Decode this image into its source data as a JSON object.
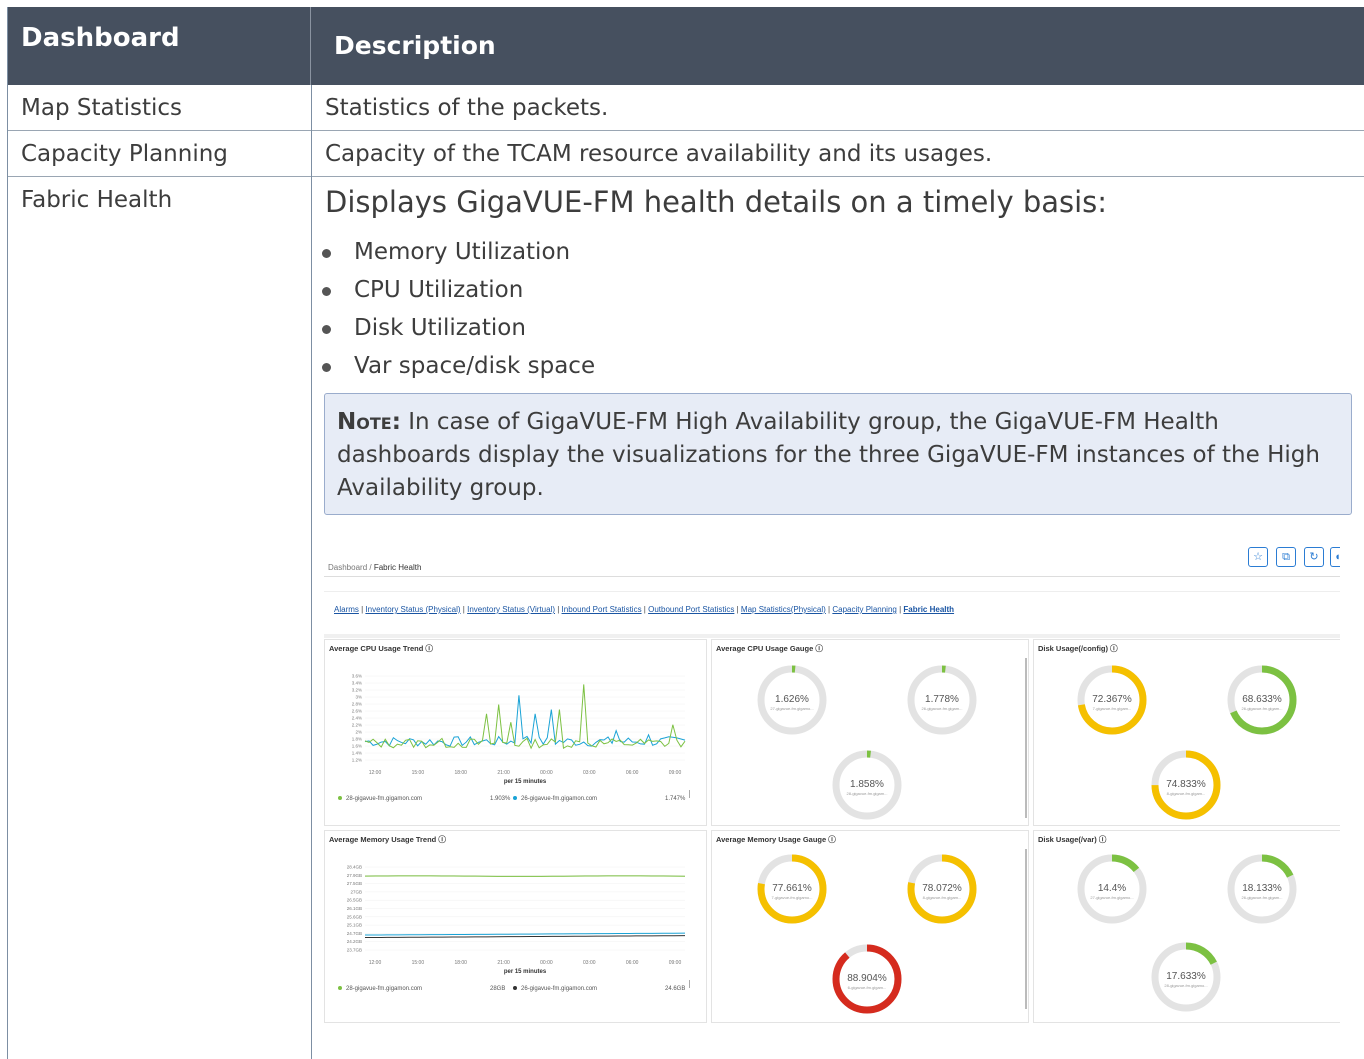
{
  "table": {
    "headers": [
      "Dashboard",
      "Description"
    ],
    "rows": [
      {
        "name": "Map Statistics",
        "desc": "Statistics of the packets."
      },
      {
        "name": "Capacity Planning",
        "desc": "Capacity of the TCAM resource availability and its usages."
      },
      {
        "name": "Fabric Health",
        "desc": "Displays GigaVUE-FM health details on a timely basis:"
      }
    ],
    "bullets": [
      "Memory Utilization",
      "CPU Utilization",
      "Disk Utilization",
      "Var space/disk space"
    ],
    "note_label": "Note:",
    "note_text": "In case of GigaVUE-FM High Availability group, the GigaVUE-FM Health dashboards display the visualizations for the three GigaVUE-FM instances of the High Availability group."
  },
  "screenshot": {
    "breadcrumb": [
      "Dashboard",
      "Fabric Health"
    ],
    "toolbar_icons": [
      "star-icon",
      "copy-icon",
      "refresh-icon",
      "more-icon"
    ],
    "links": [
      "Alarms",
      "Inventory Status (Physical)",
      "Inventory Status (Virtual)",
      "Inbound Port Statistics",
      "Outbound Port Statistics",
      "Map Statistics(Physical)",
      "Capacity Planning",
      "Fabric Health"
    ],
    "panels": {
      "cpu_trend": {
        "title": "Average CPU Usage Trend",
        "y_ticks": [
          "3.6%",
          "3.4%",
          "3.2%",
          "3%",
          "2.8%",
          "2.6%",
          "2.4%",
          "2.2%",
          "2%",
          "1.8%",
          "1.6%",
          "1.4%",
          "1.2%"
        ],
        "x_ticks": [
          "12:00",
          "15:00",
          "18:00",
          "21:00",
          "00:00",
          "03:00",
          "06:00",
          "09:00"
        ],
        "xlabel": "per 15 minutes",
        "legend": [
          {
            "name": "28-gigavue-fm.gigamon.com",
            "value": "1.903%",
            "color": "#7cc142"
          },
          {
            "name": "26-gigavue-fm.gigamon.com",
            "value": "1.747%",
            "color": "#1aa3d6"
          }
        ]
      },
      "cpu_gauge": {
        "title": "Average CPU Usage Gauge",
        "gauges": [
          {
            "value": "1.626%",
            "label": "27-gigavue-fm.gigamo...",
            "pct": 1.626
          },
          {
            "value": "1.778%",
            "label": "26-gigavue-fm.gigam...",
            "pct": 1.778
          },
          {
            "value": "1.858%",
            "label": "28-gigavue-fm.gigam...",
            "pct": 1.858
          }
        ]
      },
      "disk_config": {
        "title": "Disk Usage(/config)",
        "gauges": [
          {
            "value": "72.367%",
            "label": "7-gigavue-fm.gigam...",
            "pct": 72.367
          },
          {
            "value": "68.633%",
            "label": "26-gigavue-fm.gigam...",
            "pct": 68.633
          },
          {
            "value": "74.833%",
            "label": "8-gigavue-fm.gigam...",
            "pct": 74.833
          }
        ]
      },
      "mem_trend": {
        "title": "Average Memory Usage Trend",
        "y_ticks": [
          "28.4GB",
          "27.9GB",
          "27.5GB",
          "27GB",
          "26.5GB",
          "26.1GB",
          "25.6GB",
          "25.1GB",
          "24.7GB",
          "24.2GB",
          "23.7GB"
        ],
        "x_ticks": [
          "12:00",
          "15:00",
          "18:00",
          "21:00",
          "00:00",
          "03:00",
          "06:00",
          "09:00"
        ],
        "xlabel": "per 15 minutes",
        "legend": [
          {
            "name": "28-gigavue-fm.gigamon.com",
            "value": "28GB",
            "color": "#7cc142"
          },
          {
            "name": "26-gigavue-fm.gigamon.com",
            "value": "24.6GB",
            "color": "#333333"
          }
        ]
      },
      "mem_gauge": {
        "title": "Average Memory Usage Gauge",
        "gauges": [
          {
            "value": "77.661%",
            "label": "7-gigavue-fm.gigamo...",
            "pct": 77.661
          },
          {
            "value": "78.072%",
            "label": "8-gigavue-fm.gigam...",
            "pct": 78.072
          },
          {
            "value": "88.904%",
            "label": "6-gigavue-fm.gigam...",
            "pct": 88.904
          }
        ]
      },
      "disk_var": {
        "title": "Disk Usage(/var)",
        "gauges": [
          {
            "value": "14.4%",
            "label": "27-gigavue-fm.gigamo...",
            "pct": 14.4
          },
          {
            "value": "18.133%",
            "label": "26-gigavue-fm.gigam...",
            "pct": 18.133
          },
          {
            "value": "17.633%",
            "label": "28-gigavue-fm.gigamo...",
            "pct": 17.633
          }
        ]
      }
    }
  }
}
